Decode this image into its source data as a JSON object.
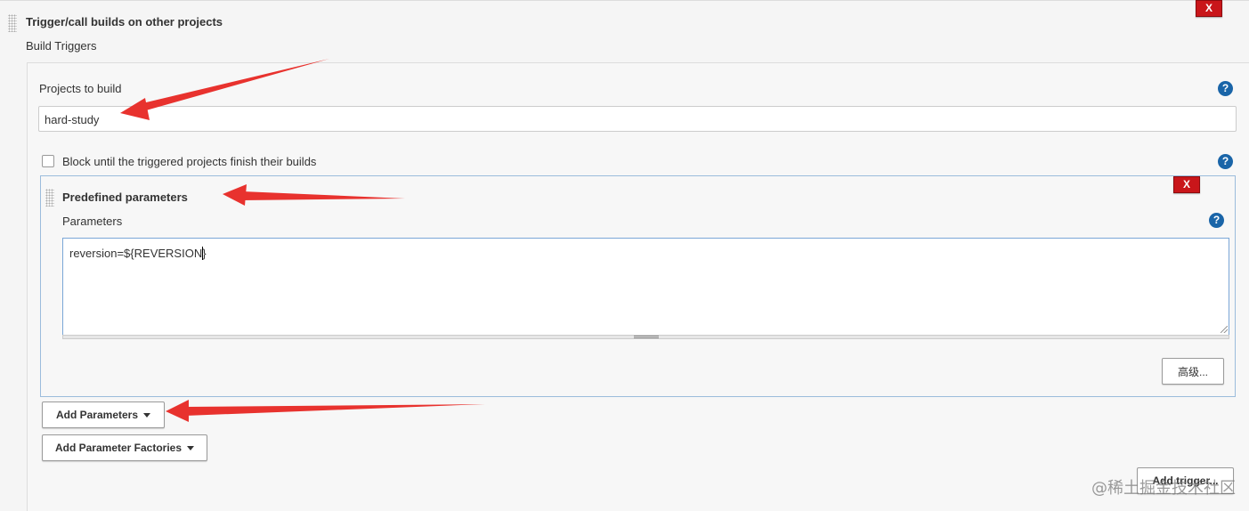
{
  "section": {
    "title": "Trigger/call builds on other projects",
    "subtitle": "Build Triggers",
    "delete_label": "X"
  },
  "projects": {
    "label": "Projects to build",
    "value": "hard-study"
  },
  "block": {
    "label": "Block until the triggered projects finish their builds",
    "checked": false
  },
  "predefined": {
    "title": "Predefined parameters",
    "delete_label": "X",
    "params_label": "Parameters",
    "params_value": "reversion=${REVERSION}",
    "advanced_label": "高级..."
  },
  "buttons": {
    "add_parameters": "Add Parameters",
    "add_parameter_factories": "Add Parameter Factories",
    "add_trigger": "Add trigger..."
  },
  "help_label": "?",
  "watermark": "@稀土掘金技术社区",
  "colors": {
    "delete_red": "#c9161a",
    "help_blue": "#1a65a8",
    "annotation_arrow": "#e8322e"
  }
}
